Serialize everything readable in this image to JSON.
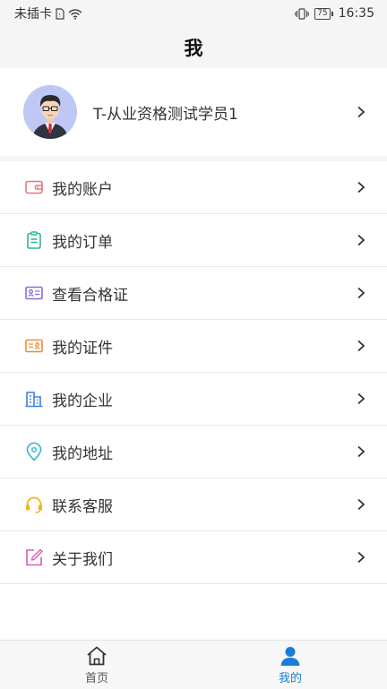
{
  "status_bar": {
    "carrier": "未插卡",
    "battery": "75",
    "time": "16:35"
  },
  "header": {
    "title": "我"
  },
  "profile": {
    "name": "T-从业资格测试学员1"
  },
  "menu": [
    {
      "label": "我的账户",
      "icon": "wallet-icon",
      "color": "#e8777d"
    },
    {
      "label": "我的订单",
      "icon": "clipboard-icon",
      "color": "#2bb596"
    },
    {
      "label": "查看合格证",
      "icon": "id-card-icon",
      "color": "#8a6dd6"
    },
    {
      "label": "我的证件",
      "icon": "certificate-icon",
      "color": "#ee8c35"
    },
    {
      "label": "我的企业",
      "icon": "building-icon",
      "color": "#3f7fe0"
    },
    {
      "label": "我的地址",
      "icon": "location-pin-icon",
      "color": "#2fb6d4"
    },
    {
      "label": "联系客服",
      "icon": "headset-icon",
      "color": "#f5b315"
    },
    {
      "label": "关于我们",
      "icon": "edit-icon",
      "color": "#d95bb0"
    }
  ],
  "tabbar": {
    "tabs": [
      {
        "label": "首页",
        "icon": "home-icon",
        "active": false
      },
      {
        "label": "我的",
        "icon": "user-icon",
        "active": true
      }
    ],
    "active_color": "#1a7cd9"
  }
}
